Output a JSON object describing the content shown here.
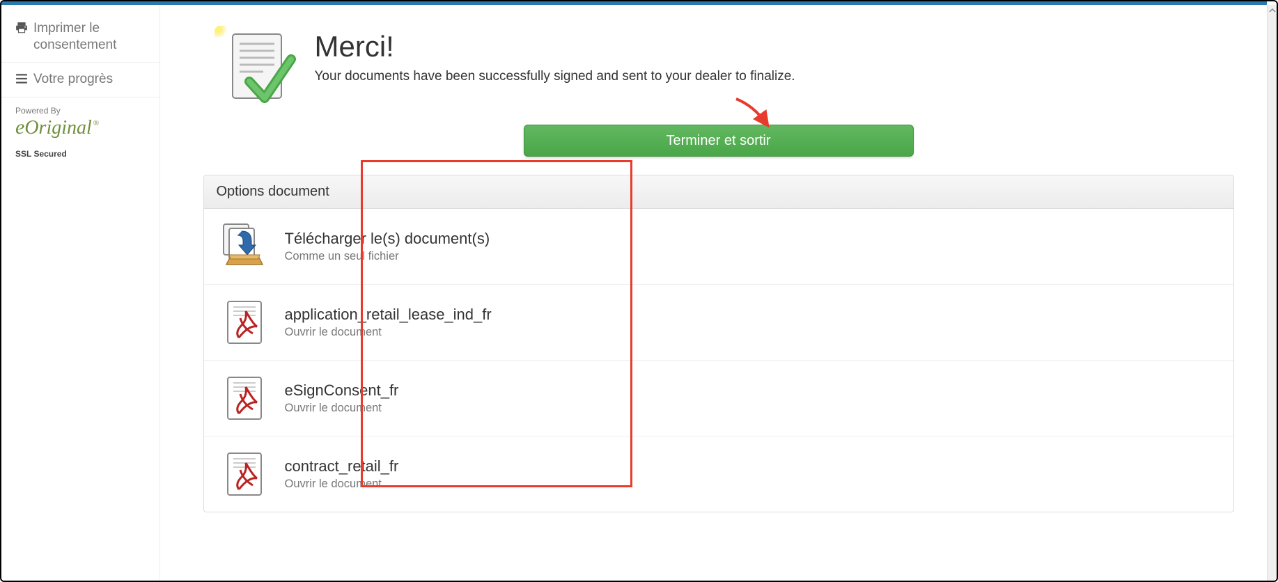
{
  "sidebar": {
    "items": [
      {
        "label": "Imprimer le consentement"
      },
      {
        "label": "Votre progrès"
      }
    ],
    "powered_by": "Powered By",
    "brand": "eOriginal",
    "ssl_secured": "SSL Secured"
  },
  "main": {
    "title": "Merci!",
    "subtitle": "Your documents have been successfully signed and sent to your dealer to finalize.",
    "finish_button": "Terminer et sortir",
    "options_header": "Options document",
    "options": [
      {
        "title": "Télécharger le(s) document(s)",
        "sub": "Comme un seul fichier"
      },
      {
        "title": "application_retail_lease_ind_fr",
        "sub": "Ouvrir le document"
      },
      {
        "title": "eSignConsent_fr",
        "sub": "Ouvrir le document"
      },
      {
        "title": "contract_retail_fr",
        "sub": "Ouvrir le document"
      }
    ]
  },
  "colors": {
    "accent_green": "#4aa648",
    "annotation_red": "#e83b2d",
    "top_bar_blue": "#2a7ab0",
    "logo_green": "#6f8f3b"
  }
}
